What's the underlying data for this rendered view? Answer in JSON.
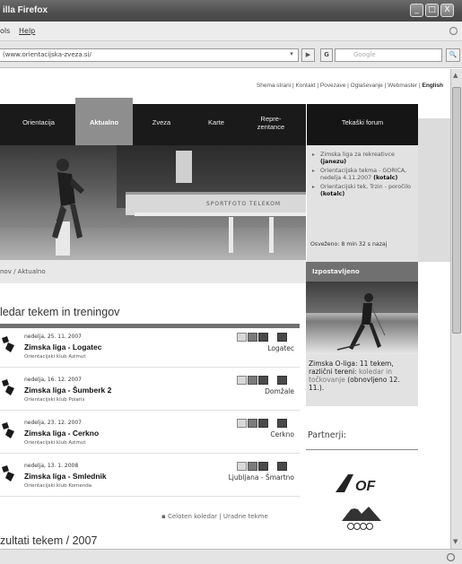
{
  "window": {
    "title": "illa Firefox",
    "min": "_",
    "max": "□",
    "close": "X"
  },
  "menu": {
    "tools": "ols",
    "help": "Help"
  },
  "toolbar": {
    "url": "(www.orientacijska-zveza.si/",
    "search_placeholder": "Google",
    "search_engine": "G"
  },
  "toplinks": {
    "text": "Shema strani | Kontakt | Povezave | Oglaševanje | Webmaster | ",
    "lang": "English"
  },
  "nav": {
    "items": [
      {
        "label": "Orientacija"
      },
      {
        "label": "Aktualno"
      },
      {
        "label": "Zveza"
      },
      {
        "label": "Karte"
      },
      {
        "label": "Repre-\nzentance"
      }
    ],
    "forum": "Tekaški forum"
  },
  "hero": {
    "banner_text": "SPORTFOTO TELEKOM"
  },
  "breadcrumb": "nov / Aktualno",
  "calendar": {
    "title": "ledar tekem in treningov",
    "events": [
      {
        "date": "nedelja, 25. 11. 2007",
        "name": "Zimska liga - Logatec",
        "club": "Orientacijski klub Azimut",
        "location": "Logatec"
      },
      {
        "date": "nedelja, 16. 12. 2007",
        "name": "Zimska liga - Šumberk 2",
        "club": "Orientacijski klub Polaris",
        "location": "Domžale"
      },
      {
        "date": "nedelja, 23. 12. 2007",
        "name": "Zimska liga - Cerkno",
        "club": "Orientacijski klub Azimut",
        "location": "Cerkno"
      },
      {
        "date": "nedelja, 13. 1. 2008",
        "name": "Zimska liga - Smlednik",
        "club": "Orientacijski klub Komenda",
        "location": "Ljubljana - Šmartno"
      }
    ],
    "more": "▪ Celoten koledar | Uradne tekme"
  },
  "results_title": "zultati tekem / 2007",
  "sidebar": {
    "news": [
      {
        "text": "Zimska liga za rekreativce ",
        "author": "(janezu)"
      },
      {
        "text": "Orientacijska tekma - GORICA, nedelja 4.11.2007 ",
        "author": "(kotalc)"
      },
      {
        "text": "Orientacijski tek, Trzin - poročilo ",
        "author": "(kotalc)"
      }
    ],
    "updated": "Osveženo: 8 min 32 s nazaj",
    "izpostavljeno": "Izpostavljeno",
    "caption_text": "Zimska O-liga: 11 tekem, različni tereni: ",
    "caption_link": "koledar in točkovanje",
    "caption_tail": " (obnovljeno 12. 11.).",
    "partners": "Partnerji:",
    "logo_text": "OF"
  }
}
